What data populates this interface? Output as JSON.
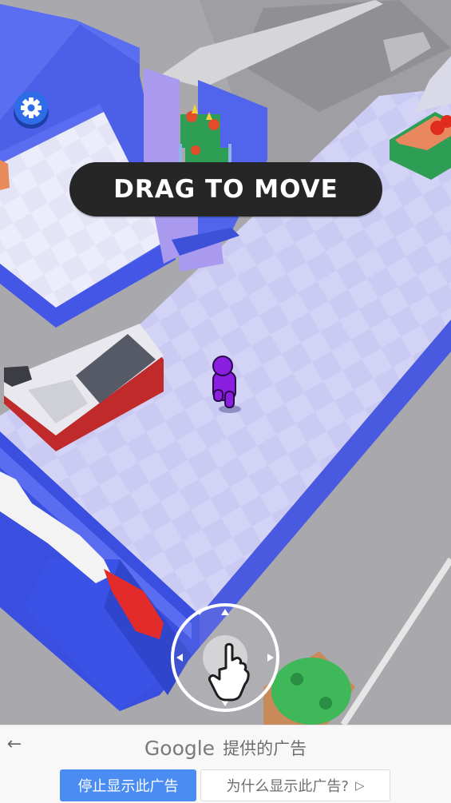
{
  "game": {
    "tutorial_text": "DRAG TO MOVE",
    "settings_icon": "gear-icon",
    "joystick_icon": "pointing-hand-icon",
    "colors": {
      "floor": "#c9c9f2",
      "wall": "#5566e6",
      "player": "#8a1fe0",
      "ground": "#a9a9ad"
    }
  },
  "ad": {
    "brand": "Google",
    "provided_label": "提供的广告",
    "stop_label": "停止显示此广告",
    "why_label": "为什么显示此广告?",
    "back_icon": "back-arrow-icon",
    "play_icon": "ad-choices-icon",
    "accent_color": "#4a8cf2"
  }
}
